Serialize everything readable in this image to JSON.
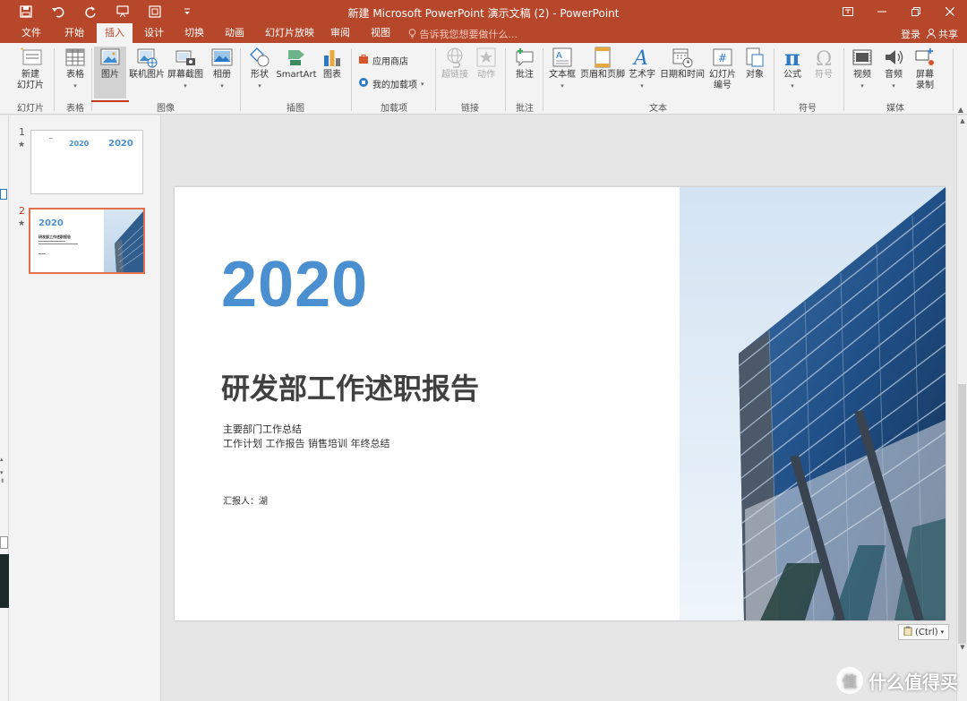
{
  "titlebar": {
    "title": "新建 Microsoft PowerPoint 演示文稿 (2) - PowerPoint",
    "qat": [
      "save-icon",
      "undo-icon",
      "redo-icon",
      "present-icon",
      "screenshot-icon",
      "customize-icon"
    ],
    "window_buttons": [
      "ribbon-options-icon",
      "minimize-icon",
      "restore-icon",
      "close-icon"
    ]
  },
  "tabs": [
    {
      "label": "文件"
    },
    {
      "label": "开始"
    },
    {
      "label": "插入"
    },
    {
      "label": "设计"
    },
    {
      "label": "切换"
    },
    {
      "label": "动画"
    },
    {
      "label": "幻灯片放映"
    },
    {
      "label": "审阅"
    },
    {
      "label": "视图"
    }
  ],
  "active_tab": "插入",
  "tell_me": "告诉我您想要做什么...",
  "login": "登录",
  "share": "共享",
  "ribbon": {
    "new_slide": "新建\n幻灯片",
    "table": "表格",
    "picture": "图片",
    "online_picture": "联机图片",
    "screenshot": "屏幕截图",
    "album": "相册",
    "shapes": "形状",
    "smartart": "SmartArt",
    "chart": "图表",
    "store": "应用商店",
    "my_addins": "我的加载项",
    "hyperlink": "超链接",
    "action": "动作",
    "comment": "批注",
    "textbox": "文本框",
    "header_footer": "页眉和页脚",
    "wordart": "艺术字",
    "datetime": "日期和时间",
    "slide_number_l1": "幻灯片",
    "slide_number_l2": "编号",
    "object": "对象",
    "equation": "公式",
    "symbol": "符号",
    "video": "视频",
    "audio": "音频",
    "screen_rec_l1": "屏幕",
    "screen_rec_l2": "录制",
    "new_slide_l1": "新建",
    "new_slide_l2": "幻灯片",
    "groups": {
      "slides": "幻灯片",
      "tables": "表格",
      "images": "图像",
      "illustrations": "插图",
      "addins": "加载项",
      "links": "链接",
      "comments": "批注",
      "text": "文本",
      "symbols": "符号",
      "media": "媒体"
    }
  },
  "thumbnails": [
    {
      "number": "1",
      "star": "★",
      "year_a": "2020",
      "year_b": "2020"
    },
    {
      "number": "2",
      "star": "★",
      "year": "2020",
      "title": "研发部工作述职报告"
    }
  ],
  "slide": {
    "year": "2020",
    "title": "研发部工作述职报告",
    "subtitle_line1": "主要部门工作总结",
    "subtitle_line2": "工作计划 工作报告 销售培训 年终总结",
    "reporter": "汇报人：湖"
  },
  "paste_options": "(Ctrl)",
  "watermark": "什么值得买",
  "colors": {
    "accent": "#b7472a",
    "year_blue": "#4a8fcf"
  }
}
